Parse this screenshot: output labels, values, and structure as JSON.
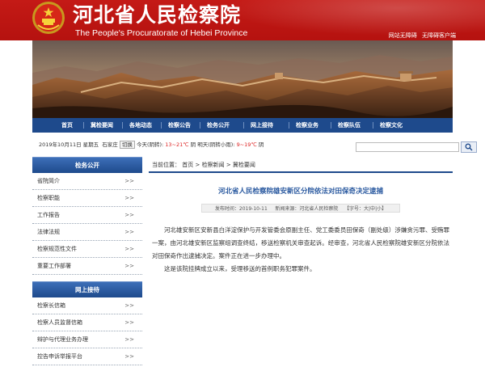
{
  "header": {
    "title_cn": "河北省人民检察院",
    "title_en": "The People's Procuratorate of Hebei Province",
    "links": [
      "网站无障碍",
      "无障碍客户端"
    ]
  },
  "nav": {
    "items": [
      "首页",
      "冀检要闻",
      "各地动态",
      "检察公告",
      "检务公开",
      "网上接待",
      "检察业务",
      "检察队伍",
      "检察文化"
    ]
  },
  "info": {
    "date": "2019年10月11日 星期五",
    "city": "石家庄",
    "loc_label": "切换",
    "today_label": "今天(阴转):",
    "today_temp": "13~21℃",
    "today_wind": "阴",
    "tomorrow_label": "明天(阴转小雨):",
    "tomorrow_temp": "9~19℃",
    "tomorrow_wind": "阴"
  },
  "search": {
    "value": ""
  },
  "sidebar": {
    "section1_title": "检务公开",
    "section1_items": [
      "省院简介",
      "检察职能",
      "工作报告",
      "法律法规",
      "检察规范性文件",
      "重要工作部署"
    ],
    "section2_title": "网上接待",
    "section2_items": [
      "检察长信箱",
      "检察人员监督信箱",
      "辩护与代理业务办理",
      "控告申诉举报平台"
    ],
    "arrow": ">>"
  },
  "breadcrumb": {
    "prefix": "当前位置：",
    "items": [
      "首页",
      "检察新闻",
      "冀检要闻"
    ],
    "sep": ">"
  },
  "article": {
    "title": "河北省人民检察院雄安新区分院依法对田保奇决定逮捕",
    "date_label": "发布时间：",
    "date": "2019-10-11",
    "source_label": "新闻来源：",
    "source": "河北省人民检察院",
    "font_label": "【字号：",
    "font_sizes": [
      "大",
      "中",
      "小"
    ],
    "font_end": "】",
    "paragraphs": [
      "河北雄安新区安新县白洋淀保护与开发管委会原副主任、党工委委员田保奇（副处级）涉嫌贪污罪、受贿罪一案，由河北雄安新区监察组调查终结，移送检察机关审查起诉。经审查，河北省人民检察院雄安新区分院依法对田保奇作出逮捕决定。案件正在进一步办理中。",
      "这是该院挂牌成立以来，受理移送的首例职务犯罪案件。"
    ]
  },
  "colors": {
    "header_red": "#c41a16",
    "nav_blue": "#1e4a8c",
    "title_blue": "#2b5aa0"
  },
  "icons": {
    "emblem": "national-emblem-icon",
    "search": "search-icon"
  }
}
